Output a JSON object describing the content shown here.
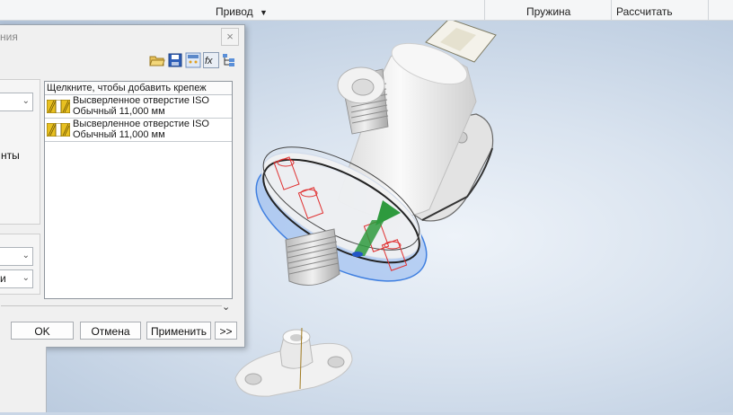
{
  "ribbon": {
    "groups": [
      {
        "id": "drive",
        "label": "Привод",
        "has_dropdown": true
      },
      {
        "id": "spring",
        "label": "Пружина"
      },
      {
        "id": "calculate",
        "label": "Рассчитать"
      }
    ]
  },
  "dialog": {
    "title_fragment": "ния",
    "close_glyph": "×",
    "left_text_fragment": "нты",
    "lower_combo_fragment": "и",
    "fastener_list": {
      "header": "Щелкните, чтобы добавить крепеж",
      "items": [
        {
          "line1": "Высверленное отверстие ISO",
          "line2": "Обычный 11,000 мм"
        },
        {
          "line1": "Высверленное отверстие ISO",
          "line2": "Обычный 11,000 мм"
        }
      ]
    },
    "buttons": {
      "ok": "OK",
      "cancel": "Отмена",
      "apply": "Применить",
      "more": ">>"
    },
    "expand_glyph": "⌄"
  },
  "colors": {
    "accent_blue": "#3f7fe0",
    "hole_red": "#e03030",
    "arrow_green": "#2e9a3e",
    "icon_yellow": "#e8c020"
  }
}
